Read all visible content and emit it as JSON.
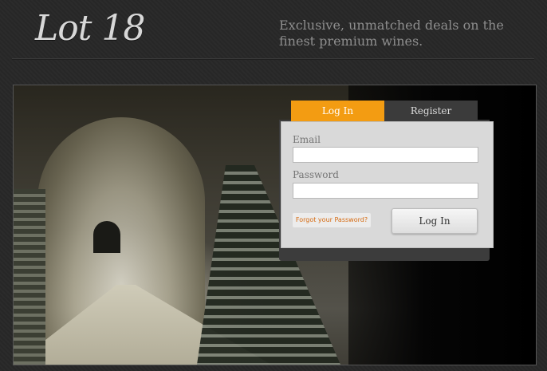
{
  "header": {
    "logo_text": "Lot 18",
    "tagline": "Exclusive, unmatched deals on the finest premium wines."
  },
  "auth": {
    "tabs": {
      "login": "Log In",
      "register": "Register"
    },
    "email_label": "Email",
    "email_value": "",
    "password_label": "Password",
    "password_value": "",
    "forgot_link": "Forgot your Password?",
    "submit_label": "Log In"
  },
  "colors": {
    "accent": "#f39c12",
    "background": "#2b2b2b",
    "panel": "#d9d9d9",
    "link": "#d66a10"
  }
}
